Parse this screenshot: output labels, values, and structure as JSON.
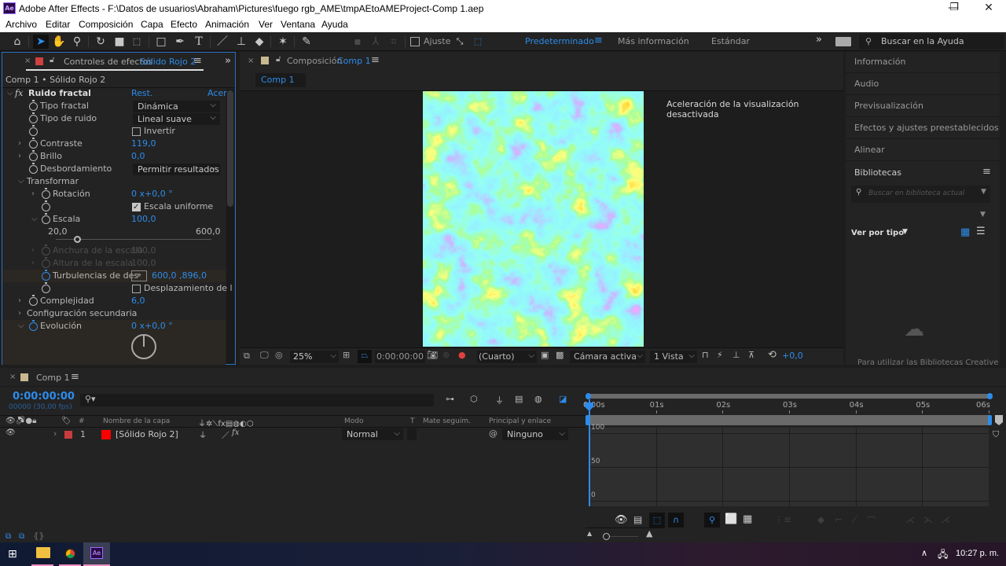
{
  "window": {
    "app_badge": "Ae",
    "title": "Adobe After Effects - F:\\Datos de usuarios\\Abraham\\Pictures\\fuego rgb_AME\\tmpAEtoAMEProject-Comp 1.aep",
    "controls": {
      "minimize": "—",
      "maximize": "❐",
      "close": "✕"
    }
  },
  "menubar": [
    "Archivo",
    "Editar",
    "Composición",
    "Capa",
    "Efecto",
    "Animación",
    "Ver",
    "Ventana",
    "Ayuda"
  ],
  "toolbar": {
    "snap_label": "Ajuste",
    "workspaces": [
      {
        "label": "Predeterminado",
        "active": true
      },
      {
        "label": "Más información",
        "active": false
      },
      {
        "label": "Estándar",
        "active": false
      }
    ],
    "overflow": "»",
    "help_search_placeholder": "Buscar en la Ayuda"
  },
  "effects_panel": {
    "tab_prefix": "Controles de efectos",
    "tab_layer": "Sólido Rojo 2",
    "breadcrumb": "Comp 1 • Sólido Rojo 2",
    "effect_name": "Ruido fractal",
    "reset_label": "Rest.",
    "about_label": "Acer",
    "rows": {
      "tipo_fractal": {
        "label": "Tipo fractal",
        "value": "Dinámica"
      },
      "tipo_ruido": {
        "label": "Tipo de ruido",
        "value": "Lineal suave"
      },
      "invertir": {
        "label": "Invertir",
        "checked": false
      },
      "contraste": {
        "label": "Contraste",
        "value": "119,0"
      },
      "brillo": {
        "label": "Brillo",
        "value": "0,0"
      },
      "desbordamiento": {
        "label": "Desbordamiento",
        "value": "Permitir resultados"
      },
      "transformar": {
        "label": "Transformar"
      },
      "rotacion": {
        "label": "Rotación",
        "value": "0 x+0,0 °"
      },
      "escala_uniforme": {
        "label": "Escala uniforme",
        "checked": true
      },
      "escala": {
        "label": "Escala",
        "value": "100,0",
        "min": "20,0",
        "max": "600,0",
        "slider_fraction": 0.138
      },
      "anchura": {
        "label": "Anchura de la escala",
        "value": "100,0"
      },
      "altura": {
        "label": "Altura de la escala",
        "value": "100,0"
      },
      "turbulencias": {
        "label": "Turbulencias de des",
        "value": "600,0 ,896,0"
      },
      "desplazamiento": {
        "label": "Desplazamiento de l",
        "checked": false
      },
      "complejidad": {
        "label": "Complejidad",
        "value": "6,0"
      },
      "config_secundaria": {
        "label": "Configuración secundaria"
      },
      "evolucion": {
        "label": "Evolución",
        "value": "0 x+0,0 °"
      }
    }
  },
  "comp_panel": {
    "tab_prefix": "Composición",
    "tab_comp": "Comp 1",
    "subtab": "Comp 1",
    "notice": "Aceleración de la visualización desactivada",
    "footer": {
      "zoom": "25%",
      "timecode": "0:00:00:00",
      "resolution": "(Cuarto)",
      "camera": "Cámara activa",
      "views": "1 Vista",
      "exposure": "+0,0"
    }
  },
  "right_panel": {
    "items": [
      "Información",
      "Audio",
      "Previsualización",
      "Efectos y ajustes preestablecidos",
      "Alinear"
    ],
    "libraries": {
      "title": "Bibliotecas",
      "search_placeholder": "Buscar en biblioteca actual",
      "view_by": "Ver por tipo",
      "message": "Para utilizar las Bibliotecas Creative"
    }
  },
  "timeline": {
    "tab": "Comp 1",
    "timecode": "0:00:00:00",
    "frames": "00000 (30,00 fps)",
    "search_placeholder": "",
    "columns": {
      "number": "#",
      "layer_name": "Nombre de la capa",
      "mode": "Modo",
      "t": "T",
      "track_matte": "Mate seguim.",
      "parent": "Principal y enlace"
    },
    "layers": [
      {
        "number": "1",
        "name": "[Sólido Rojo 2]",
        "color": "#ff0000",
        "label_color": "#c83c3c",
        "mode": "Normal",
        "parent": "Ninguno"
      }
    ],
    "ruler": [
      "0:00s",
      "01s",
      "02s",
      "03s",
      "04s",
      "05s",
      "06s"
    ],
    "graph_y_labels": [
      "100",
      "50",
      "0"
    ]
  },
  "taskbar": {
    "clock": "10:27 p. m.",
    "apps": [
      "start",
      "file-explorer",
      "chrome",
      "after-effects"
    ]
  },
  "colors": {
    "accent": "#2d8ceb",
    "panel_bg": "#232323",
    "layer_solid": "#ff0000",
    "label_red": "#c83c3c",
    "comp_tab": "#c8b890"
  }
}
